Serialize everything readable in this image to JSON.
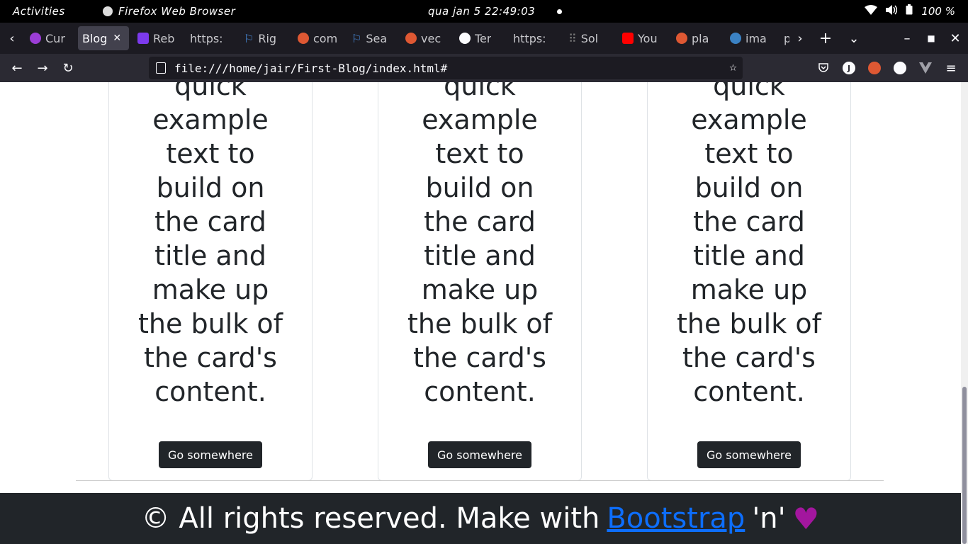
{
  "system": {
    "activities": "Activities",
    "app_name": "Firefox Web Browser",
    "clock": "qua jan 5 22:49:03",
    "battery": "100 %"
  },
  "tabs": [
    {
      "label": "Cur",
      "color": "#9b3dd6"
    },
    {
      "label": "Blog",
      "color": ""
    },
    {
      "label": "Reb",
      "color": "#7c3aed"
    },
    {
      "label": "https:",
      "color": ""
    },
    {
      "label": "Rig",
      "color": "#4a90e2"
    },
    {
      "label": "com",
      "color": "#de5833"
    },
    {
      "label": "Sea",
      "color": "#4a90e2"
    },
    {
      "label": "vec",
      "color": "#de5833"
    },
    {
      "label": "Ter",
      "color": "#fbfbfe"
    },
    {
      "label": "https:",
      "color": ""
    },
    {
      "label": "Sol",
      "color": "#555"
    },
    {
      "label": "You",
      "color": "#ff0000"
    },
    {
      "label": "pla",
      "color": "#de5833"
    },
    {
      "label": "ima",
      "color": "#3b82c4"
    },
    {
      "label": "p",
      "color": ""
    }
  ],
  "address": {
    "url": "file:///home/jair/First-Blog/index.html#"
  },
  "cards": [
    {
      "lines": [
        "quick",
        "example",
        "text to",
        "build on",
        "the card",
        "title and",
        "make up",
        "the bulk of",
        "the card's",
        "content."
      ],
      "button": "Go somewhere"
    },
    {
      "lines": [
        "quick",
        "example",
        "text to",
        "build on",
        "the card",
        "title and",
        "make up",
        "the bulk of",
        "the card's",
        "content."
      ],
      "button": "Go somewhere"
    },
    {
      "lines": [
        "quick",
        "example",
        "text to",
        "build on",
        "the card",
        "title and",
        "make up",
        "the bulk of",
        "the card's",
        "content."
      ],
      "button": "Go somewhere"
    }
  ],
  "footer": {
    "prefix": "© All rights reserved. Make with",
    "link": "Bootstrap",
    "suffix": "'n'",
    "heart": "♥"
  }
}
